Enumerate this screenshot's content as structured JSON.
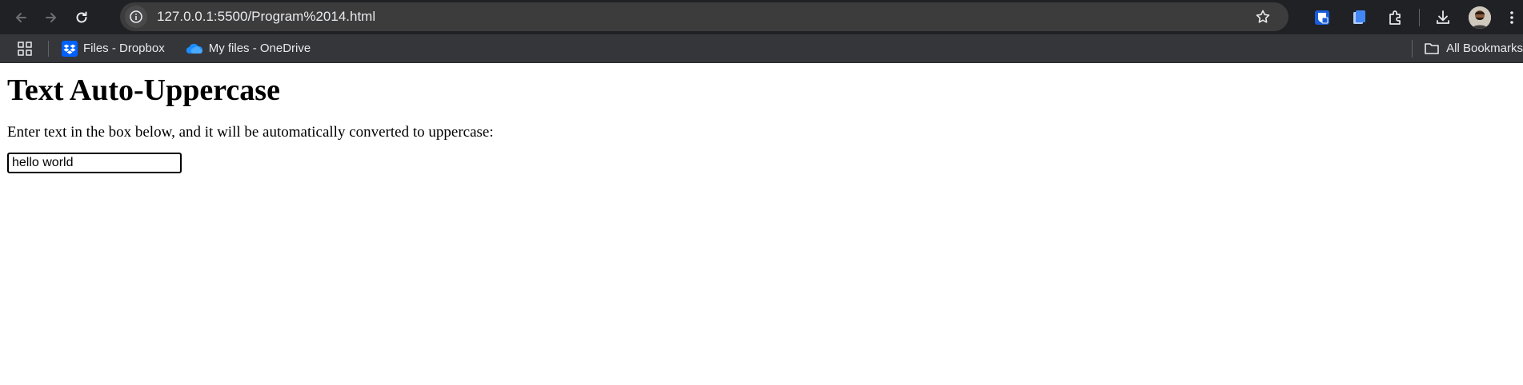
{
  "browser": {
    "url": "127.0.0.1:5500/Program%2014.html",
    "toolbar_icons": [
      "back-icon",
      "forward-icon",
      "reload-icon",
      "site-info-icon",
      "bookmark-star-icon",
      "bitwarden-icon",
      "docs-extension-icon",
      "extensions-icon",
      "download-icon",
      "avatar",
      "menu-icon"
    ]
  },
  "bookmarks": {
    "items": [
      {
        "label": "Files - Dropbox",
        "icon": "dropbox-icon"
      },
      {
        "label": "My files - OneDrive",
        "icon": "onedrive-icon"
      }
    ],
    "all_bookmarks_label": "All Bookmarks"
  },
  "page": {
    "heading": "Text Auto-Uppercase",
    "instruction": "Enter text in the box below, and it will be automatically converted to uppercase:",
    "input_value": "hello world"
  }
}
